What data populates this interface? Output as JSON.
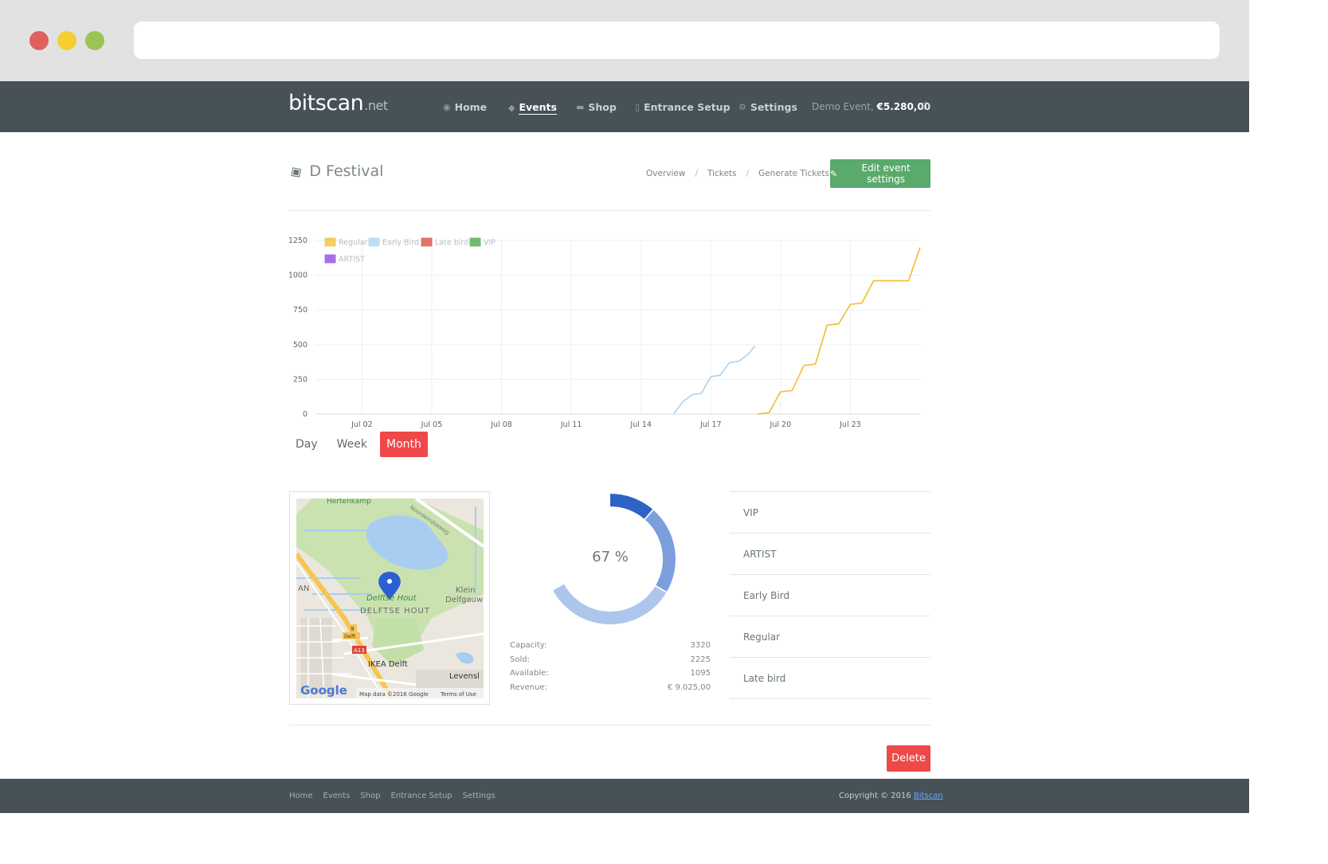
{
  "brand": {
    "name": "bitscan",
    "tld": ".net"
  },
  "nav": {
    "items": [
      {
        "label": "Home",
        "icon": "dashboard-icon",
        "glyph": "◉"
      },
      {
        "label": "Events",
        "icon": "ticket-icon",
        "glyph": "◆"
      },
      {
        "label": "Shop",
        "icon": "cart-icon",
        "glyph": "▬"
      },
      {
        "label": "Entrance Setup",
        "icon": "lock-icon",
        "glyph": "▯"
      },
      {
        "label": "Settings",
        "icon": "gears-icon",
        "glyph": "⚙"
      }
    ],
    "active": "Events",
    "account_prefix": "Demo Event,",
    "account_amount": "€5.280,00",
    "power_icon": "power-icon"
  },
  "header": {
    "title": "D Festival",
    "breadcrumbs": [
      "Overview",
      "Tickets",
      "Generate Tickets"
    ],
    "separator": "/",
    "edit_button": "Edit event settings"
  },
  "chart_data": {
    "type": "line",
    "x_tick_labels": [
      "Jul 02",
      "Jul 05",
      "Jul 08",
      "Jul 11",
      "Jul 14",
      "Jul 17",
      "Jul 20",
      "Jul 23"
    ],
    "y_tick_labels": [
      "0",
      "250",
      "500",
      "750",
      "1000",
      "1250"
    ],
    "ylim": [
      0,
      1250
    ],
    "xlim": [
      "Jun 30",
      "Jul 26"
    ],
    "grid": true,
    "legend_position": "top-left",
    "series": [
      {
        "name": "Regular",
        "color": "#f2bd2c",
        "x": [
          "Jul 19",
          "Jul 19.5",
          "Jul 20",
          "Jul 20.5",
          "Jul 21",
          "Jul 21.5",
          "Jul 22",
          "Jul 22.5",
          "Jul 23",
          "Jul 23.5",
          "Jul 24",
          "Jul 25.5",
          "Jul 26"
        ],
        "y": [
          0,
          10,
          160,
          170,
          350,
          360,
          640,
          650,
          790,
          800,
          960,
          960,
          1200
        ]
      },
      {
        "name": "Early Bird",
        "color": "#a9d3f2",
        "x": [
          "Jul 15.4",
          "Jul 15.8",
          "Jul 16.2",
          "Jul 16.6",
          "Jul 17",
          "Jul 17.4",
          "Jul 17.8",
          "Jul 18.2",
          "Jul 18.6",
          "Jul 18.9"
        ],
        "y": [
          0,
          90,
          140,
          150,
          270,
          280,
          370,
          380,
          430,
          490
        ]
      },
      {
        "name": "Late bird",
        "color": "#d9433a",
        "x": [],
        "y": []
      },
      {
        "name": "VIP",
        "color": "#3fa63f",
        "x": [],
        "y": []
      },
      {
        "name": "ARTIST",
        "color": "#8b3fe3",
        "x": [],
        "y": []
      }
    ]
  },
  "range_buttons": [
    "Day",
    "Week",
    "Month"
  ],
  "range_active": "Month",
  "map": {
    "labels": [
      "Hertenkamp",
      "Noordeindseweg",
      "Delftse Hout",
      "DELFTSE HOUT",
      "Klein",
      "Delfgauw",
      "IKEA Delft",
      "Levensl",
      "AN",
      "9",
      "Delft",
      "A13"
    ],
    "brand": "Google",
    "attribution": "Map data ©2016 Google",
    "terms": "Terms of Use"
  },
  "capacity_gauge": {
    "percent_label": "67 %",
    "sold_fraction": 0.67,
    "segment_colors": [
      "#2d63c5",
      "#7a9fdc",
      "#aec6ec"
    ]
  },
  "stats": [
    {
      "label": "Capacity:",
      "value": "3320"
    },
    {
      "label": "Sold:",
      "value": "2225"
    },
    {
      "label": "Available:",
      "value": "1095"
    },
    {
      "label": "Revenue:",
      "value": "€ 9.025,00"
    }
  ],
  "ticket_types": [
    "VIP",
    "ARTIST",
    "Early Bird",
    "Regular",
    "Late bird"
  ],
  "delete_button": "Delete",
  "footer": {
    "links": [
      "Home",
      "Events",
      "Shop",
      "Entrance Setup",
      "Settings"
    ],
    "copyright_prefix": "Copyright © 2016",
    "copyright_link": "Bitscan"
  }
}
